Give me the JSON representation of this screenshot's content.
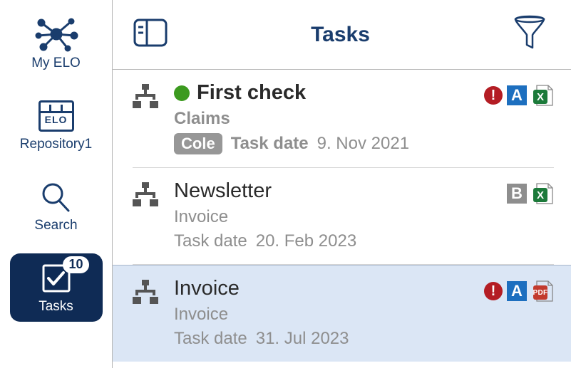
{
  "sidebar": {
    "items": [
      {
        "label": "My ELO"
      },
      {
        "label": "Repository1",
        "icon_text": "ELO"
      },
      {
        "label": "Search"
      },
      {
        "label": "Tasks",
        "count": "10"
      }
    ]
  },
  "header": {
    "title": "Tasks"
  },
  "tasks": [
    {
      "title": "First check",
      "subtitle": "Claims",
      "assignee": "Cole",
      "date_label": "Task date",
      "date_value": "9. Nov 2021",
      "priority_dot": true,
      "alert": "!",
      "letter_badge": "A",
      "letter_color": "blue",
      "file_type": "xlsx",
      "file_glyph": "X",
      "bold": true,
      "selected": false
    },
    {
      "title": "Newsletter",
      "subtitle": "Invoice",
      "assignee": null,
      "date_label": "Task date",
      "date_value": "20. Feb 2023",
      "priority_dot": false,
      "alert": null,
      "letter_badge": "B",
      "letter_color": "grey",
      "file_type": "xlsx",
      "file_glyph": "X",
      "bold": false,
      "selected": false
    },
    {
      "title": "Invoice",
      "subtitle": "Invoice",
      "assignee": null,
      "date_label": "Task date",
      "date_value": "31. Jul 2023",
      "priority_dot": false,
      "alert": "!",
      "letter_badge": "A",
      "letter_color": "blue",
      "file_type": "pdf",
      "file_glyph": "PDF",
      "bold": false,
      "selected": true
    }
  ]
}
